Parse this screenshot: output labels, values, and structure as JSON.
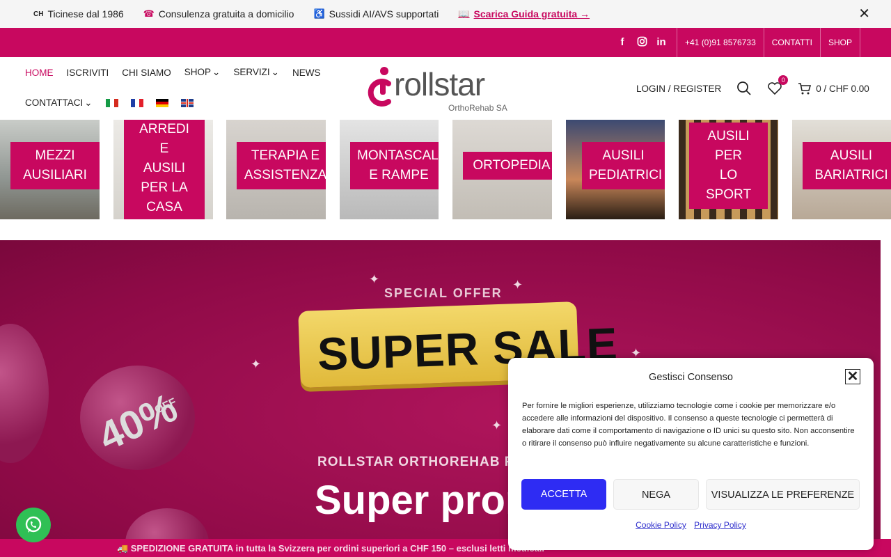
{
  "topbar": {
    "items": [
      {
        "icon": "CH",
        "text": "Ticinese dal 1986"
      },
      {
        "icon": "☎",
        "text": "Consulenza gratuita a domicilio"
      },
      {
        "icon": "♿",
        "text": "Sussidi AI/AVS supportati"
      }
    ],
    "guide_icon": "📖",
    "guide": "Scarica Guida gratuita →"
  },
  "pinkbar": {
    "phone": "+41 (0)91 8576733",
    "contacts": "CONTATTI",
    "shop": "SHOP"
  },
  "nav": {
    "row1": [
      {
        "label": "HOME",
        "active": true
      },
      {
        "label": "ISCRIVITI"
      },
      {
        "label": "CHI SIAMO"
      },
      {
        "label": "SHOP",
        "dropdown": true
      },
      {
        "label": "SERVIZI",
        "dropdown": true
      },
      {
        "label": "NEWS"
      }
    ],
    "contact": "CONTATTACI"
  },
  "logo": {
    "word": "rollstar",
    "sub": "OrthoRehab SA"
  },
  "header_right": {
    "login": "LOGIN / REGISTER",
    "wishlist_count": "0",
    "cart": "0 / CHF 0.00"
  },
  "categories": [
    "MEZZI\nAUSILIARI",
    "ARREDI\nE\nAUSILI\nPER LA\nCASA",
    "TERAPIA E\nASSISTENZA",
    "MONTASCALE\nE RAMPE",
    "ORTOPEDIA",
    "AUSILI\nPEDIATRICI",
    "AUSILI\nPER\nLO\nSPORT",
    "AUSILI\nBARIATRICI"
  ],
  "hero": {
    "special": "SPECIAL OFFER",
    "sale": "SUPER SALE",
    "percent": "40%",
    "off": "OFF",
    "brandline": "ROLLSTAR ORTHOREHAB P",
    "promo": "Super prom"
  },
  "shipbar": "🚚 SPEDIZIONE GRATUITA in tutta la Svizzera per ordini superiori a CHF 150 – esclusi letti medicali",
  "cookie": {
    "title": "Gestisci Consenso",
    "text": "Per fornire le migliori esperienze, utilizziamo tecnologie come i cookie per memorizzare e/o accedere alle informazioni del dispositivo. Il consenso a queste tecnologie ci permetterà di elaborare dati come il comportamento di navigazione o ID unici su questo sito. Non acconsentire o ritirare il consenso può influire negativamente su alcune caratteristiche e funzioni.",
    "accept": "ACCETTA",
    "deny": "NEGA",
    "prefs": "VISUALIZZA LE PREFERENZE",
    "cookie_policy": "Cookie Policy",
    "privacy_policy": "Privacy Policy"
  }
}
